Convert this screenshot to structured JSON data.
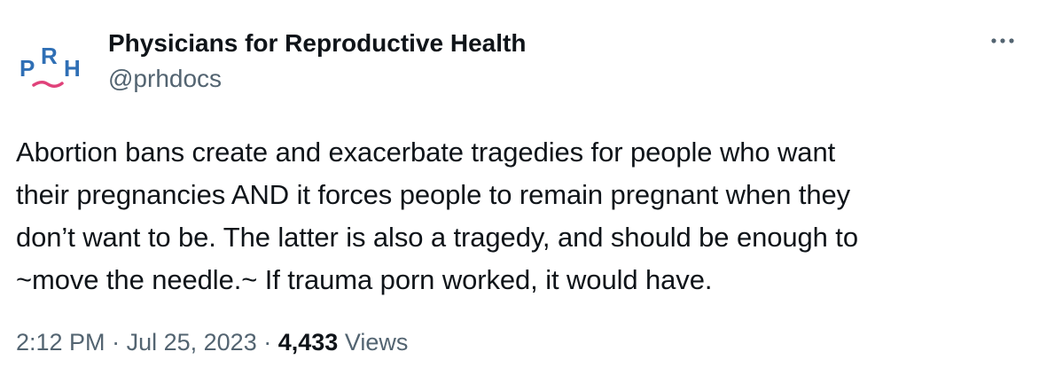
{
  "author": {
    "display_name": "Physicians for Reproductive Health",
    "handle": "@prhdocs",
    "avatar_logo_text": "PRH",
    "colors": {
      "logo_blue": "#2f6fb5",
      "logo_pink": "#e0427a"
    }
  },
  "more_menu": {
    "icon": "more-horizontal-icon"
  },
  "tweet": {
    "text": "Abortion bans create and exacerbate tragedies for people who want\ntheir pregnancies AND it forces people to remain pregnant when they\ndon’t want to be. The latter is also a tragedy, and should be enough to\n~move the needle.~ If trauma porn worked, it would have."
  },
  "meta": {
    "time": "2:12 PM",
    "separator": "·",
    "date": "Jul 25, 2023",
    "views_count": "4,433",
    "views_label": "Views"
  },
  "colors": {
    "text_primary": "#0f1419",
    "text_secondary": "#536471",
    "background": "#ffffff"
  }
}
